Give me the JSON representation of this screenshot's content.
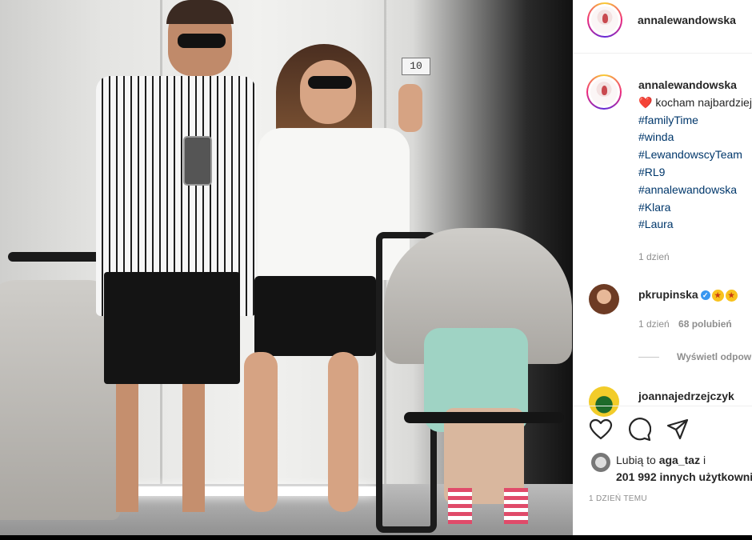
{
  "photo": {
    "floor_indicator": "10"
  },
  "header": {
    "username": "annalewandowska"
  },
  "caption": {
    "username": "annalewandowska",
    "text": "kocham najbardziej",
    "hashtags": [
      "#familyTime",
      "#winda",
      "#LewandowscyTeam",
      "#RL9",
      "#annalewandowska",
      "#Klara",
      "#Laura"
    ],
    "time": "1 dzień"
  },
  "comments": [
    {
      "username": "pkrupinska",
      "time": "1 dzień",
      "likes": "68 polubień",
      "view_replies": "Wyświetl odpowiedzi"
    },
    {
      "username": "joannajedrzejczyk"
    }
  ],
  "likes": {
    "prefix": "Lubią to",
    "user": "aga_taz",
    "connector": "i",
    "count": "201 992",
    "suffix": "innych użytkowników"
  },
  "post_date": "1 DZIEŃ TEMU",
  "colors": {
    "link": "#00376b",
    "heart": "#ed4956",
    "verified": "#3897f0",
    "muted": "#8e8e8e"
  },
  "icons": [
    "heart-icon",
    "comment-icon",
    "share-icon",
    "verified-icon"
  ]
}
